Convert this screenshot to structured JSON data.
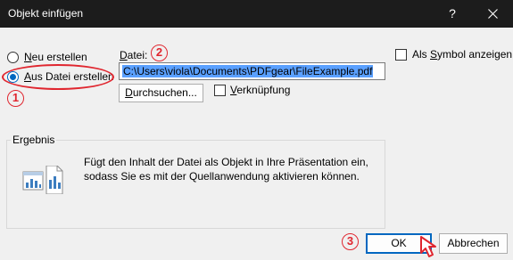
{
  "window": {
    "title": "Objekt einfügen",
    "help_label": "?"
  },
  "options": {
    "new_label_accel": "N",
    "new_label_rest": "eu erstellen",
    "from_file_label_accel": "A",
    "from_file_label_rest": "us Datei erstellen",
    "selected": "from_file"
  },
  "file": {
    "label_accel": "D",
    "label_rest": "atei:",
    "value": "C:\\Users\\viola\\Documents\\PDFgear\\FileExample.pdf",
    "browse_label_accel": "D",
    "browse_label_rest": "urchsuchen...",
    "link_label_accel": "V",
    "link_label_rest": "erknüpfung",
    "link_checked": false
  },
  "symbol": {
    "label_pre": "Als ",
    "label_accel": "S",
    "label_rest": "ymbol anzeigen",
    "checked": false
  },
  "result": {
    "title": "Ergebnis",
    "text": "Fügt den Inhalt der Datei als Objekt in Ihre Präsentation ein, sodass Sie es mit der Quellanwendung aktivieren können."
  },
  "buttons": {
    "ok": "OK",
    "cancel": "Abbrechen"
  },
  "annotations": {
    "step1": "1",
    "step2": "2",
    "step3": "3",
    "color": "#e0262f"
  },
  "colors": {
    "titlebar": "#1c1c1c",
    "accent": "#0067c0",
    "selection": "#5aa0ff"
  }
}
